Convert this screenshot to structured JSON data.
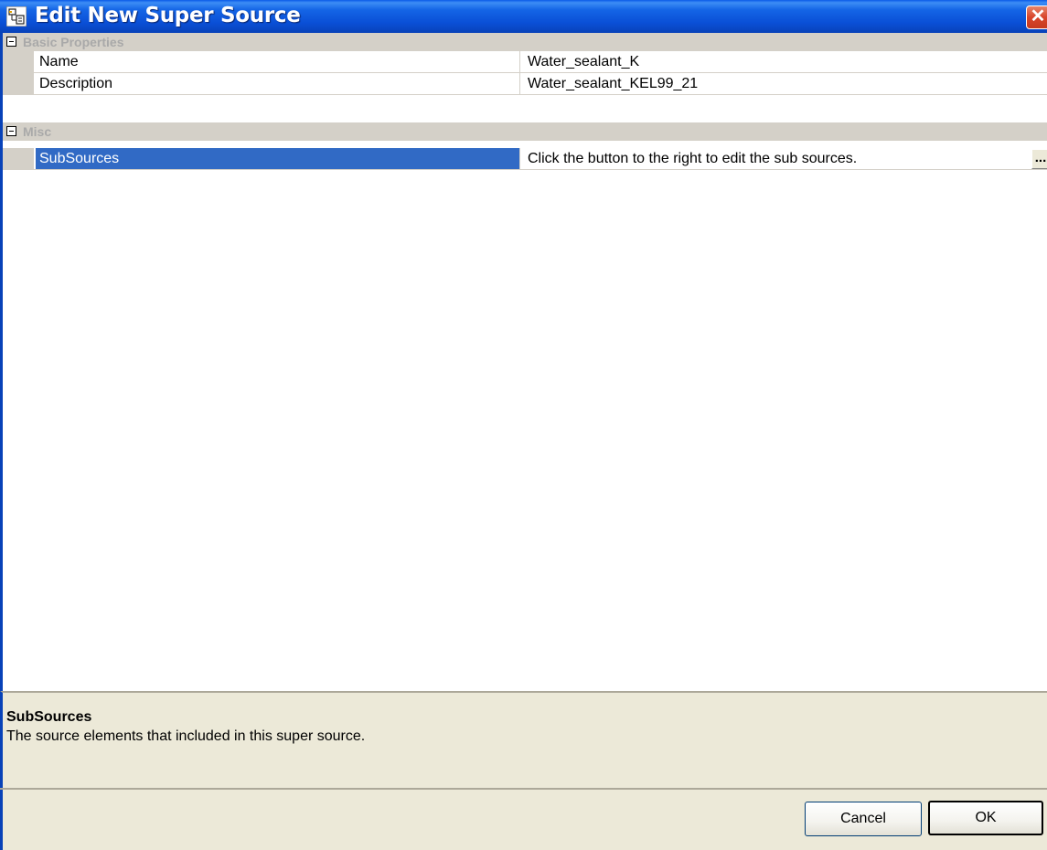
{
  "window": {
    "title": "Edit New Super Source",
    "close_symbol": "✕",
    "icon": "app-icon",
    "title_bar_color": "#0a4fd6"
  },
  "property_grid": {
    "categories": [
      {
        "label": "Basic Properties",
        "expanded": true,
        "properties": [
          {
            "name": "Name",
            "value": "Water_sealant_K"
          },
          {
            "name": "Description",
            "value": "Water_sealant_KEL99_21"
          }
        ]
      },
      {
        "label": "Misc",
        "expanded": true,
        "properties": [
          {
            "name": "SubSources",
            "value": "Click the button to the right to edit the sub sources.",
            "selected": true,
            "button_label": "..."
          }
        ]
      }
    ],
    "selection_color": "#316ac5"
  },
  "description_pane": {
    "title": "SubSources",
    "text": "The source elements that included in this super source."
  },
  "buttons": {
    "cancel": "Cancel",
    "ok": "OK"
  }
}
